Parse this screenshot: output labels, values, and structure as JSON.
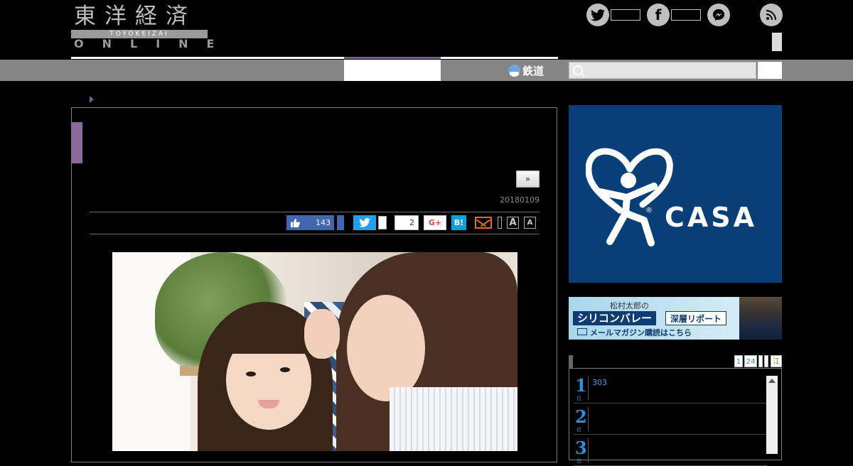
{
  "header": {
    "logo_kanji": "東洋経済",
    "logo_romaji": "TOYOKEIZAI",
    "logo_online": "ONLINE"
  },
  "social": {
    "twitter_icon": "twitter-icon",
    "facebook_icon": "facebook-icon",
    "messenger_icon": "messenger-icon",
    "rss_icon": "rss-icon"
  },
  "nav": {
    "rail_label": "鉄道"
  },
  "search": {
    "placeholder": ""
  },
  "article": {
    "next_label": "»",
    "date": "20180109",
    "share": {
      "like_count": "143",
      "fb_share_count": "2",
      "gplus_label": "G+",
      "hatena_label": "B!",
      "font_large": "A",
      "font_small": "A"
    }
  },
  "sidebar": {
    "ad_casa": {
      "wordmark": "CASA",
      "reg": "®"
    },
    "ad_silicon": {
      "author": "松村太郎の",
      "title": "シリコンバレー",
      "subtitle": "深層リポート",
      "cta": "メールマガジン購読はこちら"
    },
    "ranking": {
      "tabs": [
        "1",
        "24",
        "",
        "",
        "江"
      ],
      "items": [
        {
          "rank": "1",
          "marker": "位",
          "count": "303"
        },
        {
          "rank": "2",
          "marker": "位",
          "count": ""
        },
        {
          "rank": "3",
          "marker": "位",
          "count": ""
        }
      ]
    }
  },
  "colors": {
    "accent_purple": "#7b5c8c",
    "nav_gray": "#858585",
    "casa_blue": "#083f78",
    "facebook": "#4267b2",
    "twitter": "#1da1f2",
    "hatena": "#00a4de"
  }
}
